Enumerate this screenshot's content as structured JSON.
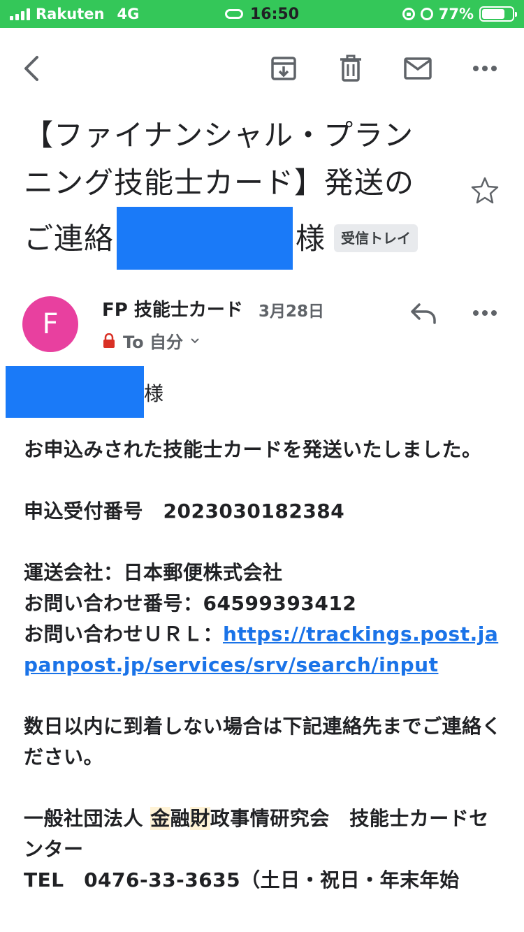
{
  "status_bar": {
    "carrier": "Rakuten",
    "network": "4G",
    "time": "16:50",
    "battery": "77%",
    "battery_level": 0.77
  },
  "toolbar": {
    "icons": [
      "back-icon",
      "archive-icon",
      "trash-icon",
      "mail-icon",
      "more-icon"
    ]
  },
  "email": {
    "subject_line1": "【ファイナンシャル・プラン",
    "subject_line2": "ニング技能士カード】発送の",
    "subject_line3_pre": "ご連絡",
    "subject_line3_post": "様",
    "label_chip": "受信トレイ",
    "sender_initial": "F",
    "sender_name": "FP 技能士カード",
    "date": "3月28日",
    "to_label": "To 自分",
    "salutation_suffix": "様",
    "body_intro": "お申込みされた技能士カードを発送いたしました。",
    "application_number": "申込受付番号　2023030182384",
    "carrier": "運送会社：日本郵便株式会社",
    "inquiry_number": "お問い合わせ番号：64599393412",
    "inquiry_url_label": "お問い合わせＵＲＬ：",
    "inquiry_url": "https://trackings.post.japanpost.jp/services/srv/search/input",
    "notice": "数日以内に到着しない場合は下記連絡先までご連絡ください。",
    "org_pre": "一般社団法人 ",
    "org_hl1": "金",
    "org_mid": "融",
    "org_hl2": "財",
    "org_post": "政事情研究会　技能士カードセンター",
    "tel": "TEL　0476-33-3635（土日・祝日・年末年始"
  },
  "colors": {
    "status_bar_bg": "#34c759",
    "avatar_bg": "#e8409f",
    "link": "#1a73e8",
    "redaction": "#1a7af8"
  }
}
